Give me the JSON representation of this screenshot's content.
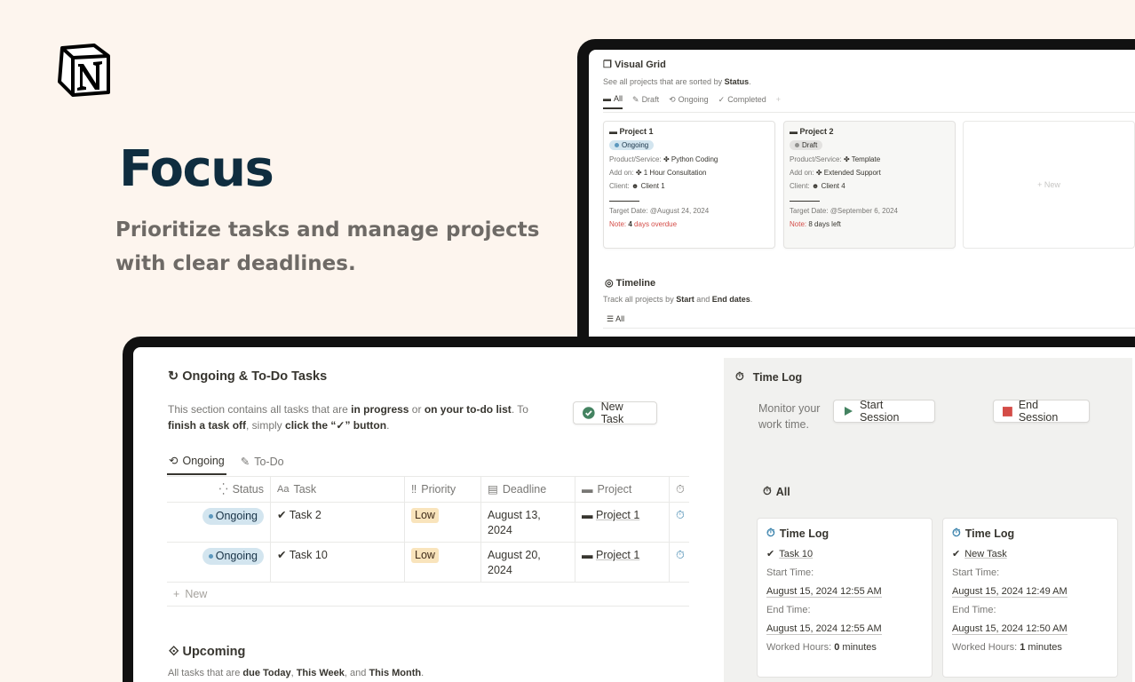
{
  "hero": {
    "title": "Focus",
    "subtitle": "Prioritize tasks and manage projects with clear deadlines."
  },
  "visual_grid": {
    "title": "Visual Grid",
    "subtitle_prefix": "See all projects that are sorted by ",
    "subtitle_bold": "Status",
    "subtitle_suffix": ".",
    "tabs": [
      {
        "label": "All",
        "icon": "folder-icon"
      },
      {
        "label": "Draft",
        "icon": "edit-icon"
      },
      {
        "label": "Ongoing",
        "icon": "refresh-icon"
      },
      {
        "label": "Completed",
        "icon": "check-icon"
      }
    ],
    "add_tab": "+",
    "cards": [
      {
        "title": "Project 1",
        "status": "Ongoing",
        "product_label": "Product/Service:",
        "product": "Python Coding",
        "addon_label": "Add on:",
        "addon": "1 Hour Consultation",
        "client_label": "Client:",
        "client": "Client 1",
        "target_label": "Target Date:",
        "target": "@August 24, 2024",
        "note_label": "Note:",
        "note_value": "4",
        "note_text": "days overdue"
      },
      {
        "title": "Project 2",
        "status": "Draft",
        "product_label": "Product/Service:",
        "product": "Template",
        "addon_label": "Add on:",
        "addon": "Extended Support",
        "client_label": "Client:",
        "client": "Client 4",
        "target_label": "Target Date:",
        "target": "@September 6, 2024",
        "note_label": "Note:",
        "note_value": "8",
        "note_text": "days left"
      }
    ],
    "new_card": "+ New"
  },
  "timeline": {
    "title": "Timeline",
    "subtitle_prefix": "Track all projects by ",
    "subtitle_b1": "Start",
    "subtitle_mid": " and ",
    "subtitle_b2": "End dates",
    "subtitle_suffix": ".",
    "view": "All"
  },
  "tasks": {
    "title": "Ongoing & To-Do Tasks",
    "desc_1": "This section contains all tasks that are ",
    "desc_b1": "in progress",
    "desc_2": " or ",
    "desc_b2": "on your to-do list",
    "desc_3": ". To ",
    "desc_b3": "finish a task off",
    "desc_4": ", simply ",
    "desc_b4": "click the “✓” button",
    "desc_5": ".",
    "new_task_button": "New Task",
    "tabs": [
      "Ongoing",
      "To-Do"
    ],
    "columns": [
      "Status",
      "Task",
      "Priority",
      "Deadline",
      "Project",
      ""
    ],
    "rows": [
      {
        "status": "Ongoing",
        "task": "Task 2",
        "priority": "Low",
        "deadline": "August 13, 2024",
        "project": "Project 1"
      },
      {
        "status": "Ongoing",
        "task": "Task 10",
        "priority": "Low",
        "deadline": "August 20, 2024",
        "project": "Project 1"
      }
    ],
    "new_row": "New"
  },
  "upcoming": {
    "title": "Upcoming",
    "desc_1": "All tasks that are ",
    "desc_b1": "due Today",
    "desc_2": ", ",
    "desc_b2": "This Week",
    "desc_3": ", and ",
    "desc_b3": "This Month",
    "desc_4": "."
  },
  "time_log": {
    "title": "Time Log",
    "monitor_text": "Monitor your work time.",
    "start_button": "Start Session",
    "end_button": "End Session",
    "view": "All",
    "cards": [
      {
        "title": "Time Log",
        "task": "Task 10",
        "start_label": "Start Time:",
        "start": "August 15, 2024 12:55 AM",
        "end_label": "End Time:",
        "end": "August 15, 2024 12:55 AM",
        "hours_label": "Worked Hours:",
        "hours_value": "0",
        "hours_unit": "minutes"
      },
      {
        "title": "Time Log",
        "task": "New Task",
        "start_label": "Start Time:",
        "start": "August 15, 2024 12:49 AM",
        "end_label": "End Time:",
        "end": "August 15, 2024 12:50 AM",
        "hours_label": "Worked Hours:",
        "hours_value": "1",
        "hours_unit": "minutes"
      }
    ]
  },
  "colors": {
    "background": "#fdf5ee",
    "hero_title": "#0f2d3f",
    "ongoing_pill": "#d3e5ef",
    "low_pill": "#f9e4bc",
    "overdue_red": "#d44c47",
    "start_green": "#448361",
    "end_red": "#d44c47",
    "stopwatch_blue": "#337ea9"
  }
}
